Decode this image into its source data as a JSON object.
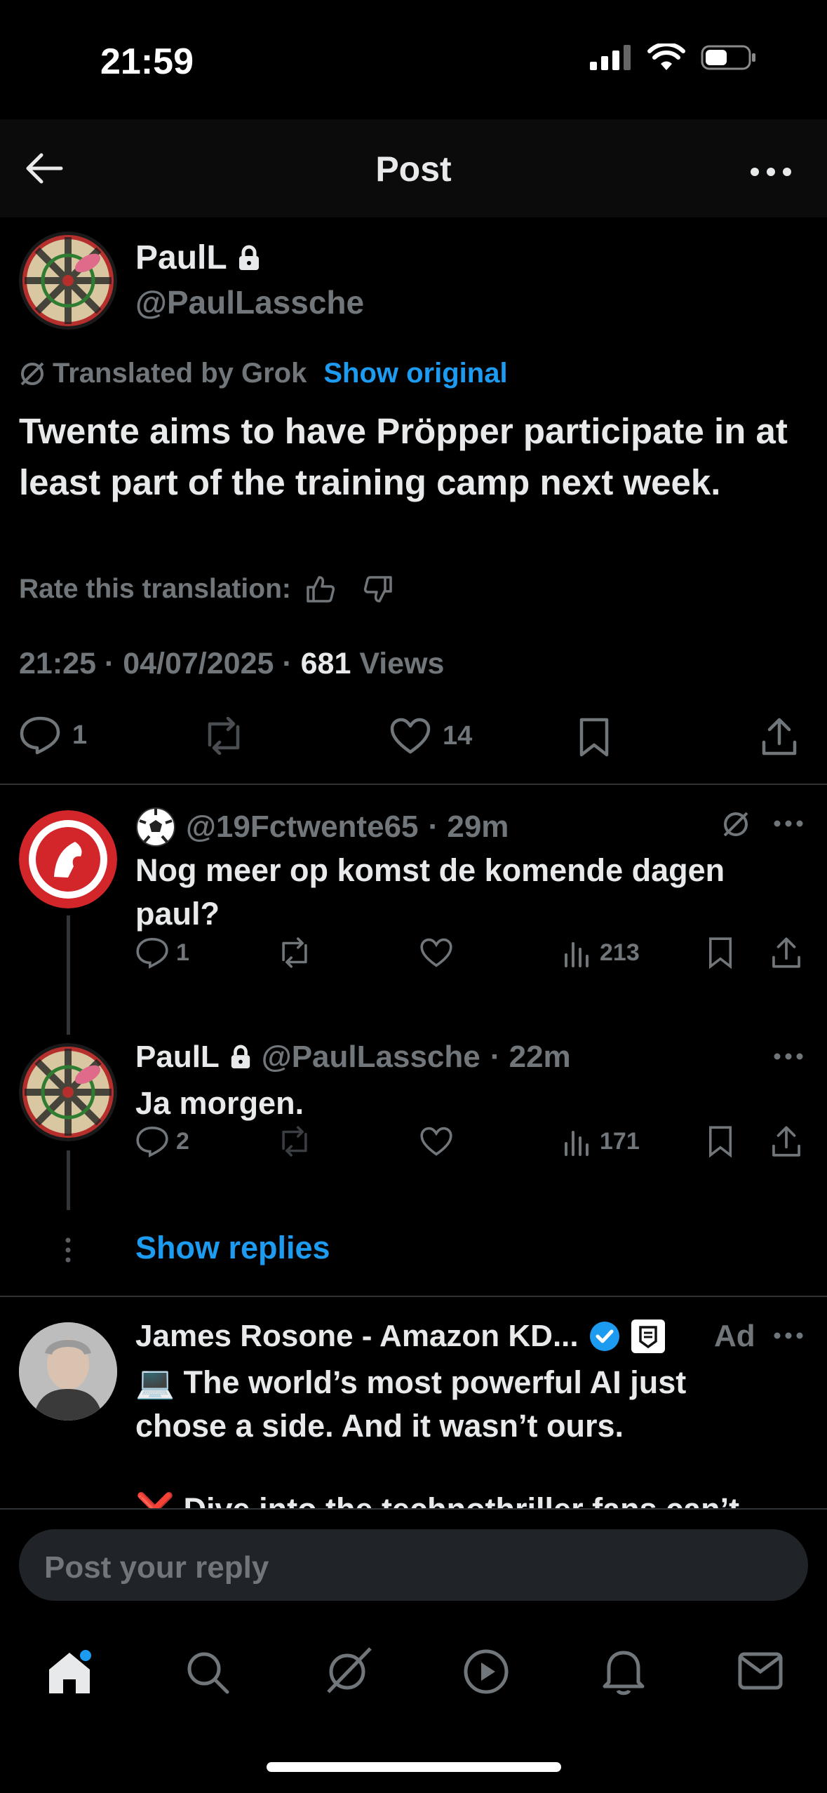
{
  "status_bar": {
    "time": "21:59"
  },
  "header": {
    "title": "Post"
  },
  "post": {
    "author_name": "PaulL",
    "author_handle": "@PaulLassche",
    "translated_label": "Translated by Grok",
    "show_original": "Show original",
    "text": "Twente aims to have Pröpper participate in at least part of the training camp next week.",
    "rate_label": "Rate this translation:",
    "timestamp": "21:25 · 04/07/2025 · ",
    "views_count": "681",
    "views_label": " Views",
    "actions": {
      "replies": "1",
      "likes": "14"
    }
  },
  "replies": [
    {
      "handle": "@19Fctwente65",
      "time": "· 29m",
      "text": "Nog meer op komst de komende dagen paul?",
      "reply_count": "1",
      "views": "213"
    },
    {
      "name": "PaulL",
      "handle": "@PaulLassche",
      "time": "· 22m",
      "text": "Ja morgen.",
      "reply_count": "2",
      "views": "171"
    }
  ],
  "show_replies": "Show replies",
  "ad": {
    "name": "James Rosone - Amazon KD...",
    "ad_label": "Ad",
    "text": "💻 The world’s most powerful AI just chose a side. And it wasn’t ours.",
    "text_cut": "❌ Dive into the technothriller fans can’t"
  },
  "reply_input": {
    "placeholder": "Post your reply"
  },
  "colors": {
    "accent": "#1d9bf0",
    "muted": "#71767b",
    "text": "#e7e9ea"
  }
}
